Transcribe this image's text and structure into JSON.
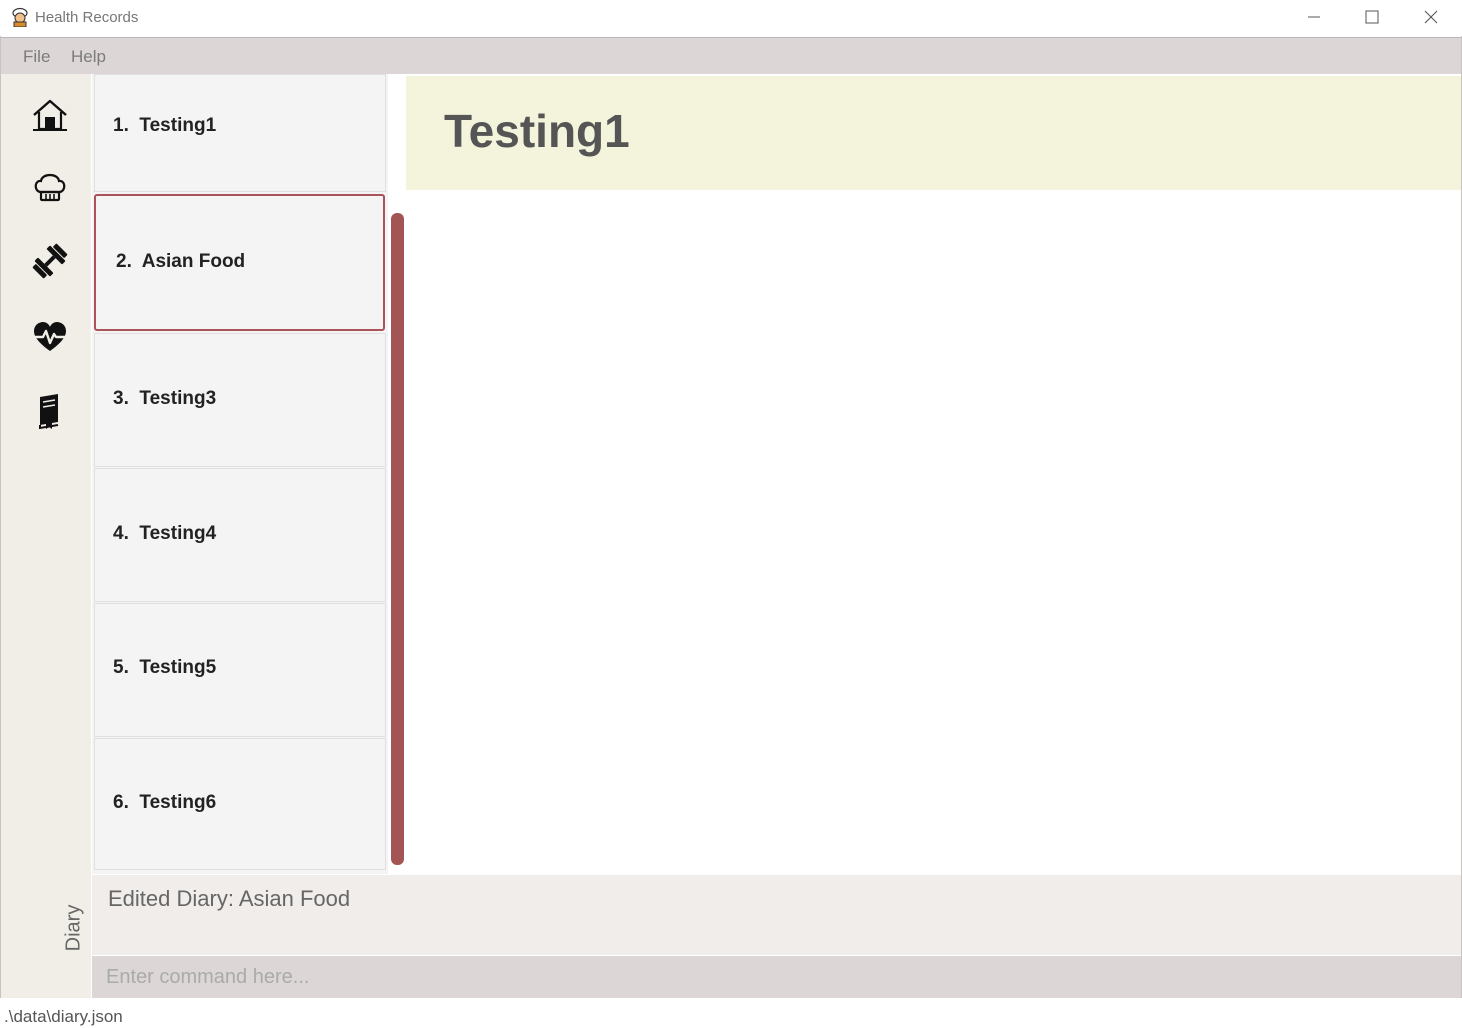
{
  "window": {
    "title": "Health Records",
    "controls": [
      "minimize-icon",
      "maximize-icon",
      "close-icon"
    ]
  },
  "menu": {
    "file": "File",
    "help": "Help"
  },
  "sidebar": {
    "icons": [
      "home-icon",
      "chef-hat-icon",
      "dumbbell-icon",
      "heartbeat-icon",
      "book-icon"
    ],
    "label": "Diary"
  },
  "list": {
    "items": [
      {
        "index": "1.",
        "title": "Testing1"
      },
      {
        "index": "2.",
        "title": "Asian Food"
      },
      {
        "index": "3.",
        "title": "Testing3"
      },
      {
        "index": "4.",
        "title": "Testing4"
      },
      {
        "index": "5.",
        "title": "Testing5"
      },
      {
        "index": "6.",
        "title": "Testing6"
      }
    ],
    "selected_index": 1
  },
  "detail": {
    "title": "Testing1"
  },
  "result": {
    "message": "Edited Diary: Asian Food"
  },
  "command": {
    "placeholder": "Enter command here...",
    "value": ""
  },
  "status": {
    "path": ".\\data\\diary.json"
  },
  "colors": {
    "accent": "#a25554",
    "header_bg": "#f4f4dc",
    "menubar_bg": "#ddd6d7",
    "sidebar_bg": "#f1eee8"
  }
}
